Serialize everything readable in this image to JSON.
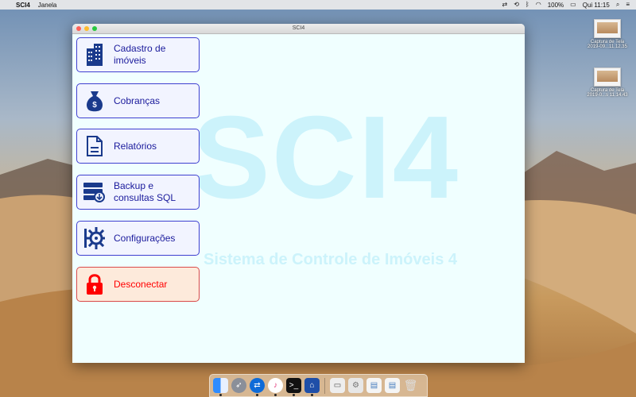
{
  "menubar": {
    "app_name": "SCI4",
    "menu_items": [
      "Janela"
    ],
    "battery": "100%",
    "clock": "Qui 11:15"
  },
  "desktop": {
    "files": [
      {
        "line1": "Captura de Tela",
        "line2": "2019-09...11.12.35"
      },
      {
        "line1": "Captura de Tela",
        "line2": "2019-0...s 11.14.43"
      }
    ]
  },
  "window": {
    "title": "SCI4",
    "watermark_title": "SCI4",
    "watermark_subtitle": "Sistema de Controle de Imóveis 4",
    "buttons": [
      {
        "line1": "Cadastro de",
        "line2": "imóveis",
        "icon": "building-icon"
      },
      {
        "line1": "Cobranças",
        "line2": "",
        "icon": "money-bag-icon"
      },
      {
        "line1": "Relatórios",
        "line2": "",
        "icon": "document-icon"
      },
      {
        "line1": "Backup e",
        "line2": "consultas SQL",
        "icon": "server-download-icon"
      },
      {
        "line1": "Configurações",
        "line2": "",
        "icon": "gear-icon"
      },
      {
        "line1": "Desconectar",
        "line2": "",
        "icon": "lock-icon"
      }
    ]
  },
  "colors": {
    "accent": "#1a1a9c",
    "button_border": "#3f3fd0",
    "danger": "#ff0000",
    "window_bg": "#f0ffff"
  },
  "dock": {
    "apps": [
      "finder-icon",
      "launchpad-icon",
      "teamviewer-icon",
      "itunes-icon",
      "terminal-icon",
      "sci4-app-icon",
      "mail-window-icon",
      "preview-icon",
      "screenshot-icon",
      "screenshot-icon",
      "trash-icon"
    ]
  }
}
